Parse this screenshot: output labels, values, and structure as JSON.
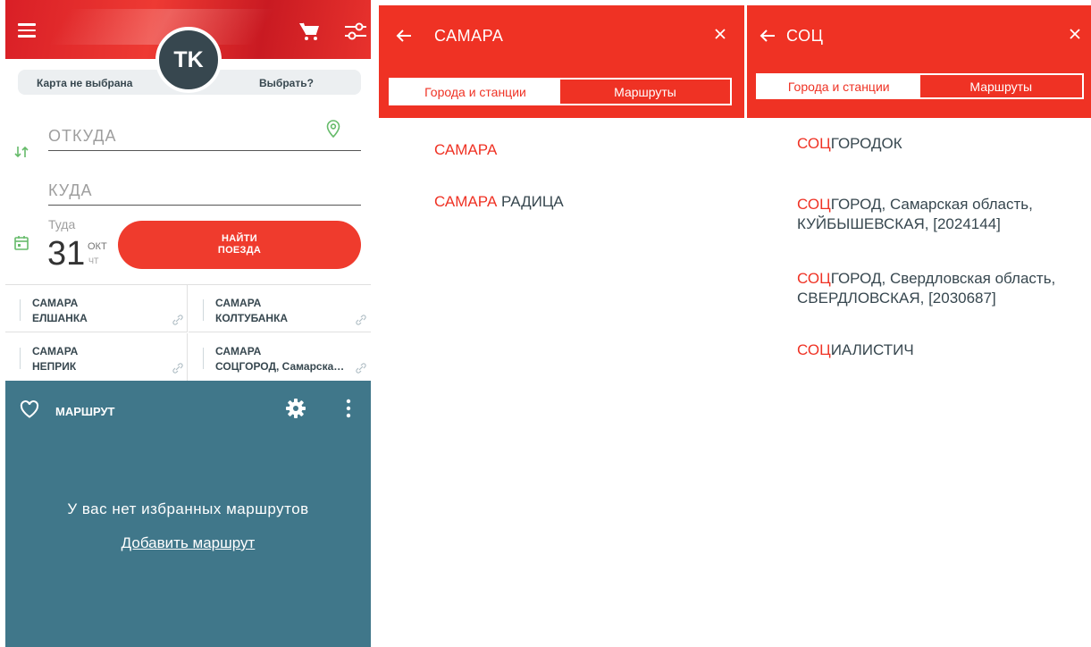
{
  "colors": {
    "brand_red": "#ef3224",
    "teal": "#40778a",
    "dark": "#37474f",
    "green_icon": "#66bb6a"
  },
  "main": {
    "avatar_initials": "TK",
    "card_status": "Карта не выбрана",
    "card_choose": "Выбрать?",
    "from_placeholder": "ОТКУДА",
    "to_placeholder": "КУДА",
    "date_label": "Туда",
    "date_day": "31",
    "date_month": "ОКТ",
    "date_weekday": "ЧТ",
    "find_button_line1": "НАЙТИ",
    "find_button_line2": "ПОЕЗДА",
    "recent_routes": [
      {
        "from": "САМАРА",
        "to": "ЕЛШАНКА"
      },
      {
        "from": "САМАРА",
        "to": "КОЛТУБАНКА"
      },
      {
        "from": "САМАРА",
        "to": "НЕПРИК"
      },
      {
        "from": "САМАРА",
        "to": "СОЦГОРОД, Самарская область"
      }
    ],
    "favorites": {
      "title": "МАРШРУТ",
      "empty_text": "У вас нет избранных маршрутов",
      "add_link": "Добавить маршрут"
    }
  },
  "search1": {
    "query": "САМАРА",
    "tabs": [
      "Города и станции",
      "Маршруты"
    ],
    "results": [
      {
        "match": "САМАРА",
        "rest": ""
      },
      {
        "match": "САМАРА",
        "rest": " РАДИЦА"
      }
    ]
  },
  "search2": {
    "query": "СОЦ",
    "tabs": [
      "Города и станции",
      "Маршруты"
    ],
    "results": [
      {
        "match": "СОЦ",
        "rest": "ГОРОДОК"
      },
      {
        "match": "СОЦ",
        "rest": "ГОРОД, Самарская область, КУЙБЫШЕВСКАЯ, [2024144]"
      },
      {
        "match": "СОЦ",
        "rest": "ГОРОД, Свердловская область, СВЕРДЛОВСКАЯ, [2030687]"
      },
      {
        "match": "СОЦ",
        "rest": "ИАЛИСТИЧ"
      }
    ]
  }
}
